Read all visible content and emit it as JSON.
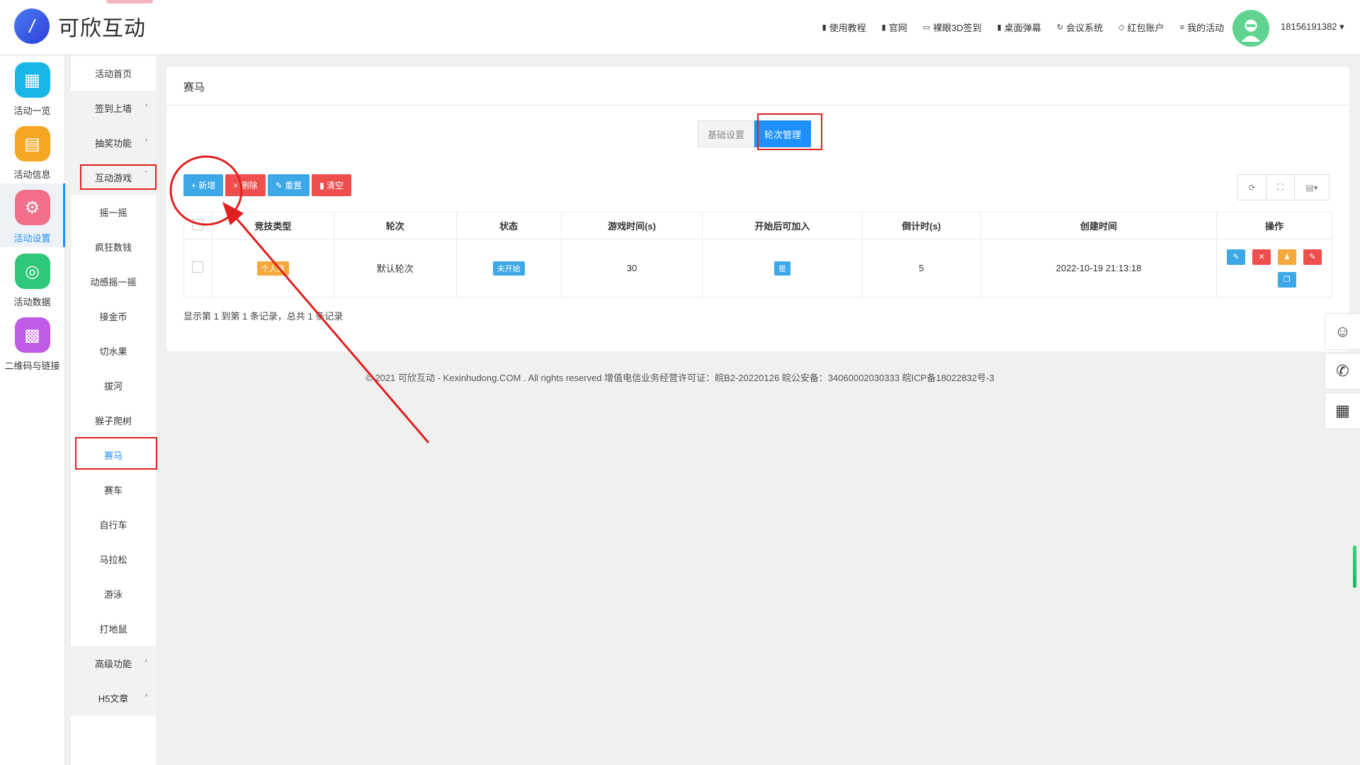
{
  "app": {
    "title": "可欣互动",
    "user_phone": "18156191382 ▾"
  },
  "topnav": [
    {
      "label": "使用教程",
      "icon": "document-icon"
    },
    {
      "label": "官网",
      "icon": "document-icon"
    },
    {
      "label": "裸眼3D签到",
      "icon": "monitor-icon"
    },
    {
      "label": "桌面弹幕",
      "icon": "document-icon"
    },
    {
      "label": "会议系统",
      "icon": "sync-icon"
    },
    {
      "label": "红包账户",
      "icon": "diamond-icon"
    },
    {
      "label": "我的活动",
      "icon": "list-icon"
    }
  ],
  "sidebar1": [
    {
      "label": "活动一览",
      "icon": "grid-icon",
      "color": "#1ab6e8"
    },
    {
      "label": "活动信息",
      "icon": "document-icon",
      "color": "#f5a623"
    },
    {
      "label": "活动设置",
      "icon": "gear-icon",
      "color": "#f26f8a",
      "active": true
    },
    {
      "label": "活动数据",
      "icon": "database-icon",
      "color": "#2fc77a"
    },
    {
      "label": "二维码与链接",
      "icon": "qrcode-icon",
      "color": "#c05ae8"
    }
  ],
  "sidebar2": [
    {
      "label": "活动首页"
    },
    {
      "label": "签到上墙",
      "chev": "›"
    },
    {
      "label": "抽奖功能",
      "chev": "›"
    },
    {
      "label": "互动游戏",
      "chev": "ˇ"
    },
    {
      "label": "摇一摇"
    },
    {
      "label": "疯狂数钱"
    },
    {
      "label": "动感摇一摇"
    },
    {
      "label": "接金币"
    },
    {
      "label": "切水果"
    },
    {
      "label": "拔河"
    },
    {
      "label": "猴子爬树"
    },
    {
      "label": "赛马"
    },
    {
      "label": "赛车"
    },
    {
      "label": "自行车"
    },
    {
      "label": "马拉松"
    },
    {
      "label": "游泳"
    },
    {
      "label": "打地鼠"
    },
    {
      "label": "高级功能",
      "chev": "›"
    },
    {
      "label": "H5文章",
      "chev": "›"
    }
  ],
  "panel": {
    "title": "赛马",
    "tabs": [
      "基础设置",
      "轮次管理"
    ],
    "toolbar": [
      "+ 新增",
      "× 删除",
      "✎ 重置",
      "▮ 清空"
    ],
    "toolright": [
      "⟳",
      "⛶",
      "▤▾"
    ],
    "columns": [
      "竞技类型",
      "轮次",
      "状态",
      "游戏时间(s)",
      "开始后可加入",
      "倒计时(s)",
      "创建时间",
      "操作"
    ],
    "rows": [
      {
        "type": "个人赛",
        "round": "默认轮次",
        "status": "未开始",
        "game_time": "30",
        "join_after_start": "是",
        "countdown": "5",
        "created": "2022-10-19 21:13:18"
      }
    ],
    "summary": "显示第 1 到第 1 条记录，总共 1 条记录"
  },
  "footer": "© 2021 可欣互动 - Kexinhudong.COM . All rights reserved 增值电信业务经营许可证：皖B2-20220126 皖公安备：34060002030333 皖ICP备18022832号-3",
  "floats": [
    "qq-icon",
    "phone-icon",
    "qrcode-icon"
  ],
  "colors": {
    "accent": "#1e90ff",
    "danger": "#ee4e4e",
    "warning": "#f6a93b",
    "annotation": "#e02020"
  }
}
